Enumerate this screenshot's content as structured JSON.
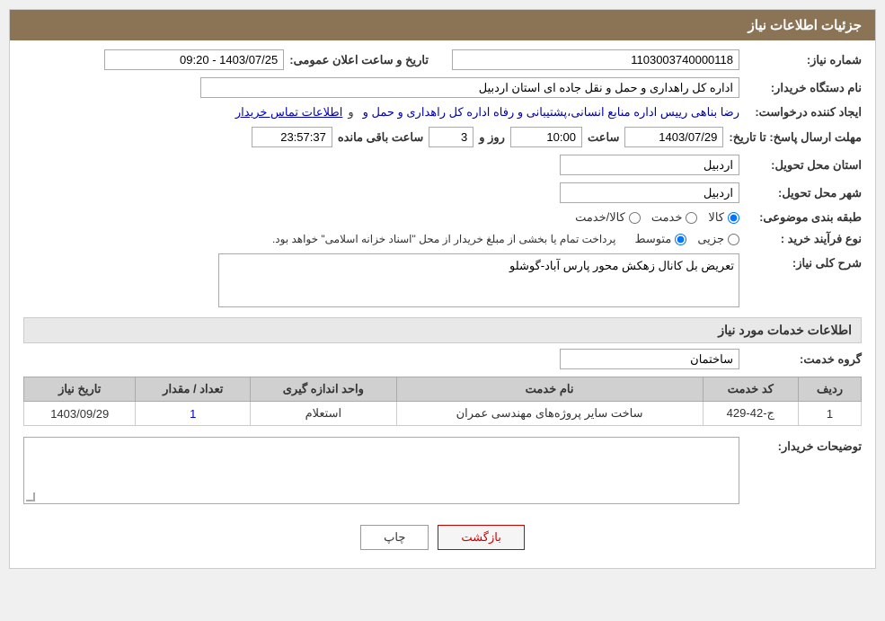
{
  "header": {
    "title": "جزئیات اطلاعات نیاز"
  },
  "fields": {
    "need_number_label": "شماره نیاز:",
    "need_number_value": "1103003740000118",
    "announce_date_label": "تاریخ و ساعت اعلان عمومی:",
    "announce_date_value": "1403/07/25 - 09:20",
    "buyer_org_label": "نام دستگاه خریدار:",
    "buyer_org_value": "اداره کل راهداری و حمل و نقل جاده ای استان اردبیل",
    "creator_label": "ایجاد کننده درخواست:",
    "creator_value": "رضا بناهی رییس اداره منابع انسانی،پشتیبانی و رفاه اداره کل راهداری و حمل و",
    "contact_link": "اطلاعات تماس خریدار",
    "deadline_label": "مهلت ارسال پاسخ: تا تاریخ:",
    "deadline_date": "1403/07/29",
    "deadline_time_label": "ساعت",
    "deadline_time": "10:00",
    "deadline_days_label": "روز و",
    "deadline_days": "3",
    "countdown_label": "ساعت باقی مانده",
    "countdown_value": "23:57:37",
    "province_label": "استان محل تحویل:",
    "province_value": "اردبیل",
    "city_label": "شهر محل تحویل:",
    "city_value": "اردبیل",
    "category_label": "طبقه بندی موضوعی:",
    "category_options": [
      {
        "label": "کالا",
        "value": "kala"
      },
      {
        "label": "خدمت",
        "value": "khedmat"
      },
      {
        "label": "کالا/خدمت",
        "value": "kala_khedmat"
      }
    ],
    "category_selected": "kala",
    "purchase_type_label": "نوع فرآیند خرید :",
    "purchase_type_options": [
      {
        "label": "جزیی",
        "value": "jozi"
      },
      {
        "label": "متوسط",
        "value": "motavasset"
      }
    ],
    "purchase_type_selected": "motavasset",
    "purchase_type_note": "پرداخت تمام یا بخشی از مبلغ خریدار از محل \"اسناد خزانه اسلامی\" خواهد بود.",
    "need_description_label": "شرح کلی نیاز:",
    "need_description_value": "تعریض بل کانال زهکش محور پارس آباد-گوشلو",
    "services_section_label": "اطلاعات خدمات مورد نیاز",
    "service_group_label": "گروه خدمت:",
    "service_group_value": "ساختمان"
  },
  "table": {
    "columns": [
      "ردیف",
      "کد خدمت",
      "نام خدمت",
      "واحد اندازه گیری",
      "تعداد / مقدار",
      "تاریخ نیاز"
    ],
    "rows": [
      {
        "row_num": "1",
        "service_code": "ج-42-429",
        "service_name": "ساخت سایر پروژه‌های مهندسی عمران",
        "unit": "استعلام",
        "quantity": "1",
        "date": "1403/09/29"
      }
    ]
  },
  "buyer_notes_label": "توضیحات خریدار:",
  "buttons": {
    "print": "چاپ",
    "back": "بازگشت"
  }
}
